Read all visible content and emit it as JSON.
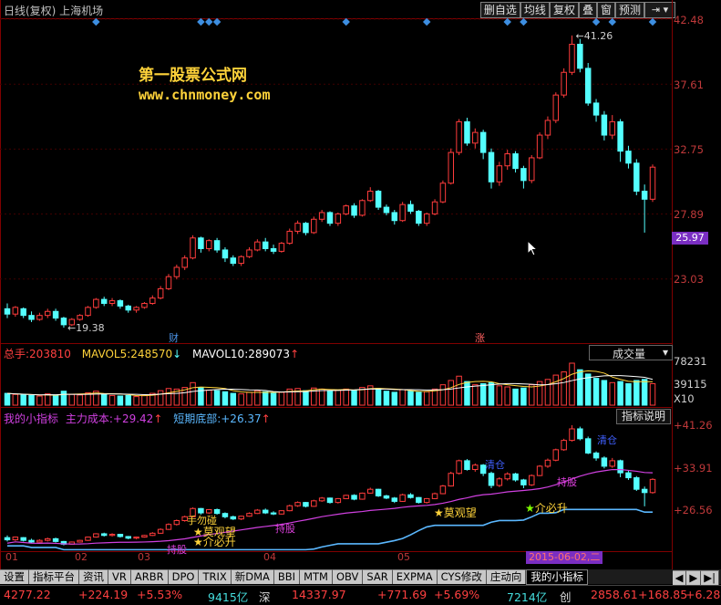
{
  "header": {
    "title": "日线(复权) 上海机场",
    "toolbar": [
      "删自选",
      "均线",
      "复权",
      "叠",
      "窗",
      "预测"
    ],
    "toolbar_arrow": "⇥ ▾"
  },
  "watermark": {
    "line1": "第一股票公式网",
    "line2": "www.chnmoney.com"
  },
  "price_axis": {
    "labels": [
      "42.48",
      "37.61",
      "32.75",
      "27.89",
      "23.03"
    ],
    "current": "25.97",
    "high_label": "41.26",
    "low_label": "19.38"
  },
  "events": {
    "cai": "财",
    "zhang": "涨"
  },
  "volume": {
    "zongshou_label": "总手:",
    "zongshou": "203810",
    "mavol5_label": "MAVOL5:",
    "mavol5": "248570",
    "mavol10_label": "MAVOL10:",
    "mavol10": "289073",
    "selector": "成交量",
    "axis": [
      "78231",
      "39115",
      "X10"
    ]
  },
  "indicator": {
    "name": "我的小指标",
    "cost_label": "主力成本:",
    "cost": "+29.42",
    "bottom_label": "短期底部:",
    "bottom": "+26.37",
    "button": "指标说明",
    "axis": [
      "+41.26",
      "+33.91",
      "+26.56"
    ],
    "annotations": [
      "手勿碰",
      "莫观望",
      "介必升",
      "持股",
      "莫观望",
      "介必升",
      "持股",
      "清仓",
      "清仓"
    ]
  },
  "dates": {
    "labels": [
      "01",
      "02",
      "03",
      "04",
      "05"
    ],
    "cursor": "2015-06-02,二"
  },
  "tabs": [
    "设置",
    "指标平台",
    "资讯",
    "VR",
    "ARBR",
    "DPO",
    "TRIX",
    "新DMA",
    "BBI",
    "MTM",
    "OBV",
    "SAR",
    "EXPMA",
    "CYS修改",
    "庄动向",
    "我的小指标"
  ],
  "status": {
    "sh_index": "4277.22",
    "sh_change": "+224.19",
    "sh_pct": "+5.53%",
    "sh_amount": "9415亿",
    "sz_label": "深",
    "sz_index": "14337.97",
    "sz_change": "+771.69",
    "sz_pct": "+5.69%",
    "sz_amount": "7214亿",
    "cy_label": "创",
    "cy_index": "2858.61",
    "cy_change": "+168.85",
    "cy_pct": "+6.28%"
  },
  "chart_data": {
    "type": "candlestick",
    "price_ylim": [
      18.5,
      42.48
    ],
    "volume_ylim": [
      0,
      78231
    ],
    "candles": [
      {
        "o": 20.8,
        "c": 20.4,
        "h": 21.2,
        "l": 20.1,
        "v": 22000
      },
      {
        "o": 20.4,
        "c": 20.9,
        "h": 21.0,
        "l": 20.2,
        "v": 20000
      },
      {
        "o": 20.8,
        "c": 20.3,
        "h": 20.9,
        "l": 20.1,
        "v": 19000
      },
      {
        "o": 20.3,
        "c": 20.0,
        "h": 20.6,
        "l": 19.8,
        "v": 18000
      },
      {
        "o": 20.0,
        "c": 20.3,
        "h": 20.5,
        "l": 19.9,
        "v": 17000
      },
      {
        "o": 20.3,
        "c": 20.6,
        "h": 20.8,
        "l": 20.1,
        "v": 21000
      },
      {
        "o": 20.6,
        "c": 20.1,
        "h": 20.8,
        "l": 19.9,
        "v": 18000
      },
      {
        "o": 20.1,
        "c": 19.6,
        "h": 20.2,
        "l": 19.38,
        "v": 26000
      },
      {
        "o": 19.6,
        "c": 20.0,
        "h": 20.1,
        "l": 19.5,
        "v": 20000
      },
      {
        "o": 20.0,
        "c": 20.3,
        "h": 20.4,
        "l": 19.9,
        "v": 19000
      },
      {
        "o": 20.3,
        "c": 20.9,
        "h": 21.0,
        "l": 20.2,
        "v": 23000
      },
      {
        "o": 20.9,
        "c": 21.5,
        "h": 21.6,
        "l": 20.8,
        "v": 26000
      },
      {
        "o": 21.5,
        "c": 21.2,
        "h": 21.7,
        "l": 21.0,
        "v": 20000
      },
      {
        "o": 21.2,
        "c": 21.4,
        "h": 21.6,
        "l": 21.0,
        "v": 18000
      },
      {
        "o": 21.4,
        "c": 21.0,
        "h": 21.5,
        "l": 20.8,
        "v": 17000
      },
      {
        "o": 21.0,
        "c": 20.7,
        "h": 21.1,
        "l": 20.5,
        "v": 18000
      },
      {
        "o": 20.7,
        "c": 20.9,
        "h": 21.0,
        "l": 20.5,
        "v": 16000
      },
      {
        "o": 20.9,
        "c": 21.2,
        "h": 21.3,
        "l": 20.8,
        "v": 19000
      },
      {
        "o": 21.2,
        "c": 21.6,
        "h": 21.8,
        "l": 21.1,
        "v": 22000
      },
      {
        "o": 21.6,
        "c": 22.3,
        "h": 22.5,
        "l": 21.5,
        "v": 27000
      },
      {
        "o": 22.3,
        "c": 23.2,
        "h": 23.4,
        "l": 22.2,
        "v": 31000
      },
      {
        "o": 23.2,
        "c": 23.9,
        "h": 24.1,
        "l": 23.0,
        "v": 30000
      },
      {
        "o": 23.9,
        "c": 24.6,
        "h": 24.8,
        "l": 23.7,
        "v": 33000
      },
      {
        "o": 24.6,
        "c": 26.1,
        "h": 26.3,
        "l": 24.5,
        "v": 42000
      },
      {
        "o": 26.1,
        "c": 25.3,
        "h": 26.2,
        "l": 25.0,
        "v": 33000
      },
      {
        "o": 25.3,
        "c": 25.9,
        "h": 26.0,
        "l": 25.1,
        "v": 28000
      },
      {
        "o": 25.9,
        "c": 25.2,
        "h": 26.1,
        "l": 25.0,
        "v": 27000
      },
      {
        "o": 25.2,
        "c": 24.6,
        "h": 25.4,
        "l": 24.3,
        "v": 25000
      },
      {
        "o": 24.6,
        "c": 24.2,
        "h": 24.8,
        "l": 24.0,
        "v": 22000
      },
      {
        "o": 24.2,
        "c": 24.7,
        "h": 24.8,
        "l": 24.0,
        "v": 21000
      },
      {
        "o": 24.7,
        "c": 25.2,
        "h": 25.4,
        "l": 24.6,
        "v": 24000
      },
      {
        "o": 25.2,
        "c": 25.8,
        "h": 26.0,
        "l": 25.1,
        "v": 27000
      },
      {
        "o": 25.8,
        "c": 25.3,
        "h": 26.1,
        "l": 25.1,
        "v": 25000
      },
      {
        "o": 25.3,
        "c": 25.1,
        "h": 25.6,
        "l": 24.9,
        "v": 22000
      },
      {
        "o": 25.1,
        "c": 25.7,
        "h": 25.8,
        "l": 25.0,
        "v": 24000
      },
      {
        "o": 25.7,
        "c": 26.6,
        "h": 26.8,
        "l": 25.6,
        "v": 30000
      },
      {
        "o": 26.6,
        "c": 27.2,
        "h": 27.4,
        "l": 26.4,
        "v": 31000
      },
      {
        "o": 27.2,
        "c": 26.5,
        "h": 27.3,
        "l": 26.3,
        "v": 27000
      },
      {
        "o": 26.5,
        "c": 27.5,
        "h": 27.7,
        "l": 26.4,
        "v": 32000
      },
      {
        "o": 27.5,
        "c": 28.0,
        "h": 28.2,
        "l": 27.3,
        "v": 30000
      },
      {
        "o": 28.0,
        "c": 27.2,
        "h": 28.1,
        "l": 27.0,
        "v": 26000
      },
      {
        "o": 27.2,
        "c": 27.9,
        "h": 28.0,
        "l": 27.0,
        "v": 28000
      },
      {
        "o": 27.9,
        "c": 28.5,
        "h": 28.6,
        "l": 27.8,
        "v": 30000
      },
      {
        "o": 28.5,
        "c": 27.8,
        "h": 28.7,
        "l": 27.6,
        "v": 27000
      },
      {
        "o": 27.8,
        "c": 28.9,
        "h": 29.0,
        "l": 27.7,
        "v": 33000
      },
      {
        "o": 28.9,
        "c": 29.6,
        "h": 29.9,
        "l": 28.8,
        "v": 36000
      },
      {
        "o": 29.6,
        "c": 28.4,
        "h": 29.7,
        "l": 28.2,
        "v": 31000
      },
      {
        "o": 28.4,
        "c": 28.0,
        "h": 28.6,
        "l": 27.8,
        "v": 26000
      },
      {
        "o": 28.0,
        "c": 27.4,
        "h": 28.2,
        "l": 27.1,
        "v": 24000
      },
      {
        "o": 27.4,
        "c": 28.6,
        "h": 28.8,
        "l": 27.3,
        "v": 29000
      },
      {
        "o": 28.6,
        "c": 28.1,
        "h": 28.9,
        "l": 27.9,
        "v": 26000
      },
      {
        "o": 28.1,
        "c": 27.2,
        "h": 28.2,
        "l": 27.0,
        "v": 24000
      },
      {
        "o": 27.2,
        "c": 27.9,
        "h": 28.0,
        "l": 27.0,
        "v": 25000
      },
      {
        "o": 27.9,
        "c": 28.8,
        "h": 29.0,
        "l": 27.8,
        "v": 30000
      },
      {
        "o": 28.8,
        "c": 30.2,
        "h": 30.4,
        "l": 28.7,
        "v": 38000
      },
      {
        "o": 30.2,
        "c": 32.5,
        "h": 32.8,
        "l": 30.1,
        "v": 46000
      },
      {
        "o": 32.5,
        "c": 34.8,
        "h": 35.0,
        "l": 32.3,
        "v": 54000
      },
      {
        "o": 34.8,
        "c": 33.2,
        "h": 35.1,
        "l": 33.0,
        "v": 44000
      },
      {
        "o": 33.2,
        "c": 34.0,
        "h": 34.3,
        "l": 32.8,
        "v": 38000
      },
      {
        "o": 34.0,
        "c": 32.5,
        "h": 34.2,
        "l": 32.0,
        "v": 40000
      },
      {
        "o": 32.5,
        "c": 30.3,
        "h": 32.8,
        "l": 29.8,
        "v": 42000
      },
      {
        "o": 30.3,
        "c": 31.5,
        "h": 31.8,
        "l": 30.0,
        "v": 36000
      },
      {
        "o": 31.5,
        "c": 32.4,
        "h": 32.7,
        "l": 31.2,
        "v": 34000
      },
      {
        "o": 32.4,
        "c": 31.3,
        "h": 32.6,
        "l": 31.0,
        "v": 30000
      },
      {
        "o": 31.3,
        "c": 30.4,
        "h": 31.5,
        "l": 29.8,
        "v": 32000
      },
      {
        "o": 30.4,
        "c": 32.1,
        "h": 32.3,
        "l": 30.2,
        "v": 38000
      },
      {
        "o": 32.1,
        "c": 33.8,
        "h": 34.0,
        "l": 32.0,
        "v": 44000
      },
      {
        "o": 33.8,
        "c": 34.9,
        "h": 35.2,
        "l": 33.5,
        "v": 48000
      },
      {
        "o": 34.9,
        "c": 36.8,
        "h": 37.0,
        "l": 34.7,
        "v": 56000
      },
      {
        "o": 36.8,
        "c": 38.5,
        "h": 38.8,
        "l": 36.6,
        "v": 62000
      },
      {
        "o": 38.5,
        "c": 40.6,
        "h": 41.26,
        "l": 38.3,
        "v": 78231
      },
      {
        "o": 40.6,
        "c": 38.8,
        "h": 41.0,
        "l": 38.5,
        "v": 66000
      },
      {
        "o": 38.8,
        "c": 36.2,
        "h": 39.2,
        "l": 36.0,
        "v": 58000
      },
      {
        "o": 36.2,
        "c": 35.3,
        "h": 36.5,
        "l": 34.8,
        "v": 50000
      },
      {
        "o": 35.3,
        "c": 33.8,
        "h": 35.6,
        "l": 33.4,
        "v": 46000
      },
      {
        "o": 33.8,
        "c": 34.8,
        "h": 35.3,
        "l": 33.5,
        "v": 42000
      },
      {
        "o": 34.8,
        "c": 32.6,
        "h": 35.0,
        "l": 31.8,
        "v": 44000
      },
      {
        "o": 32.6,
        "c": 31.7,
        "h": 33.0,
        "l": 31.3,
        "v": 40000
      },
      {
        "o": 31.7,
        "c": 29.6,
        "h": 32.0,
        "l": 29.3,
        "v": 46000
      },
      {
        "o": 29.6,
        "c": 29.0,
        "h": 30.1,
        "l": 26.5,
        "v": 48000
      },
      {
        "o": 29.0,
        "c": 31.4,
        "h": 31.6,
        "l": 28.8,
        "v": 40000
      }
    ]
  }
}
